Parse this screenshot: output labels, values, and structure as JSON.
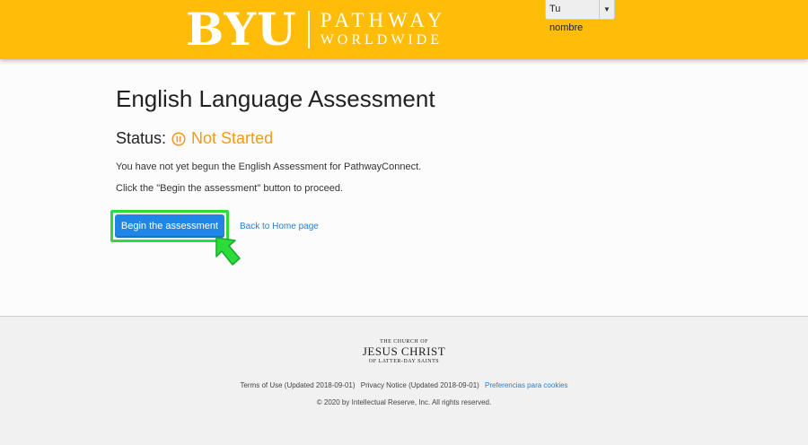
{
  "header": {
    "logo_main": "BYU",
    "logo_line1": "PATHWAY",
    "logo_line2": "WORLDWIDE",
    "user_name": "Tu nombre",
    "background_color": "#ffbc08"
  },
  "main": {
    "title": "English Language Assessment",
    "status_label": "Status:",
    "status_value": "Not Started",
    "status_icon": "pause-circle-icon",
    "status_color": "#f59a1b",
    "message1": "You have not yet begun the English Assessment for PathwayConnect.",
    "message2": "Click the \"Begin the assessment\" button to proceed.",
    "begin_button": "Begin the assessment",
    "home_link": "Back to Home page",
    "accent_color": "#1f86e6",
    "highlight_color": "#2bdc3a"
  },
  "footer": {
    "church_top": "THE CHURCH OF",
    "church_mid": "JESUS CHRIST",
    "church_bot": "OF LATTER-DAY SAINTS",
    "terms": "Terms of Use (Updated 2018-09-01)",
    "privacy": "Privacy Notice (Updated 2018-09-01)",
    "cookies": "Preferencias para cookies",
    "copyright": "© 2020 by Intellectual Reserve, Inc. All rights reserved."
  }
}
